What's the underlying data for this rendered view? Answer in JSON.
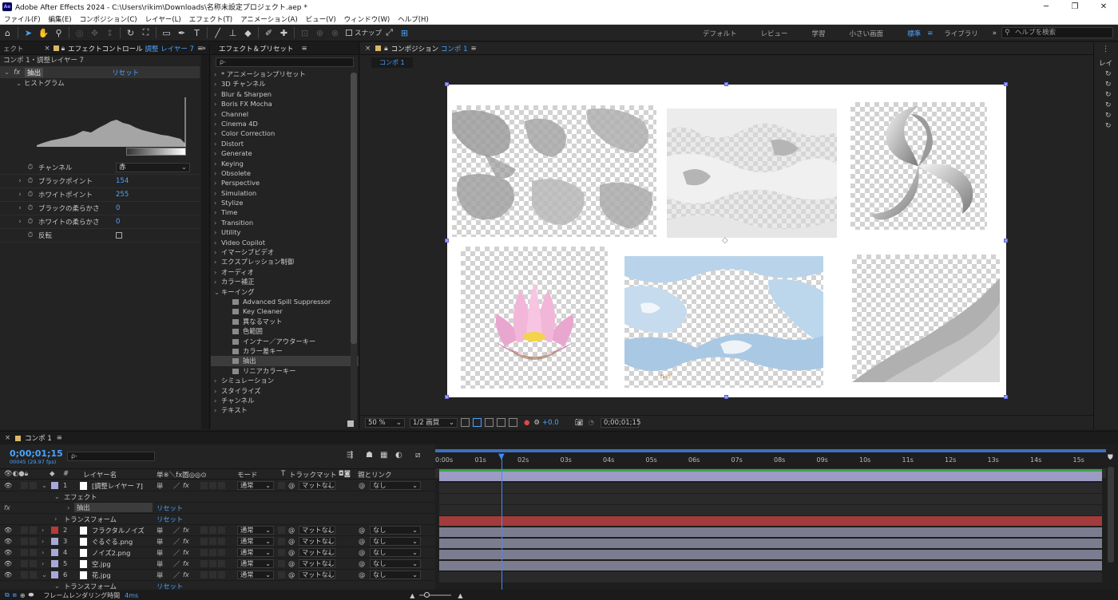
{
  "titlebar": {
    "app_icon": "Ae",
    "title": "Adobe After Effects 2024 - C:\\Users\\rikim\\Downloads\\名称未設定プロジェクト.aep *",
    "minimize": "─",
    "maximize": "❐",
    "close": "✕"
  },
  "menu": [
    "ファイル(F)",
    "編集(E)",
    "コンポジション(C)",
    "レイヤー(L)",
    "エフェクト(T)",
    "アニメーション(A)",
    "ビュー(V)",
    "ウィンドウ(W)",
    "ヘルプ(H)"
  ],
  "toolbar": {
    "snap_label": "スナップ",
    "workspaces": [
      "デフォルト",
      "レビュー",
      "学習",
      "小さい画面",
      "標準",
      "ライブラリ"
    ],
    "active_workspace": "標準",
    "more": "»",
    "help_placeholder": "ヘルプを検索"
  },
  "effect_controls": {
    "tab_left": "ェクト",
    "tab_prefix": "エフェクトコントロール",
    "tab_layer": "調整 レイヤー 7",
    "menu_icon": "≡",
    "subtitle": "コンポ 1・調整レイヤー 7",
    "effect_name": "抽出",
    "reset": "リセット",
    "histogram_label": "ヒストグラム",
    "channel_label": "チャンネル",
    "channel_value": "赤",
    "black_point_label": "ブラックポイント",
    "black_point_value": "154",
    "white_point_label": "ホワイトポイント",
    "white_point_value": "255",
    "black_soft_label": "ブラックの柔らかさ",
    "black_soft_value": "0",
    "white_soft_label": "ホワイトの柔らかさ",
    "white_soft_value": "0",
    "invert_label": "反転"
  },
  "effects_presets": {
    "tab": "エフェクト＆プリセット",
    "menu_icon": "≡",
    "search_placeholder": "ρ-",
    "items": [
      "* アニメーションプリセット",
      "3D チャンネル",
      "Blur & Sharpen",
      "Boris FX Mocha",
      "Channel",
      "Cinema 4D",
      "Color Correction",
      "Distort",
      "Generate",
      "Keying",
      "Obsolete",
      "Perspective",
      "Simulation",
      "Stylize",
      "Time",
      "Transition",
      "Utility",
      "Video Copilot",
      "イマーシブビデオ",
      "エクスプレッション制御",
      "オーディオ",
      "カラー補正"
    ],
    "expanded": "キーイング",
    "children": [
      "Advanced Spill Suppressor",
      "Key Cleaner",
      "異なるマット",
      "色範囲",
      "インナー／アウターキー",
      "カラー差キー",
      "抽出",
      "リニアカラーキー"
    ],
    "selected_child": "抽出",
    "items_after": [
      "シミュレーション",
      "スタイライズ",
      "チャンネル",
      "テキスト"
    ]
  },
  "composition": {
    "tab_prefix": "コンポジション",
    "tab_comp": "コンポ 1",
    "menu_icon": "≡",
    "subtab": "コンポ 1",
    "zoom": "50 %",
    "resolution": "1/2 画質",
    "exposure": "+0.0",
    "timecode": "0;00;01;15",
    "label_orange": "ｵﾚﾝｼﾞ"
  },
  "comp_right_panel": {
    "tab": "レイ"
  },
  "timeline": {
    "tab": "コンポ 1",
    "menu_icon": "≡",
    "timecode": "0;00;01;15",
    "frames": "00045 (29.97 fps)",
    "search_placeholder": "ρ-",
    "headers": {
      "num": "#",
      "name": "レイヤー名",
      "switches": "单※＼fx圖◎◎⊙",
      "mode": "モード",
      "t": "T",
      "trackmatte": "トラックマット",
      "parent": "親とリンク"
    },
    "ruler": [
      "0:00s",
      "01s",
      "02s",
      "03s",
      "04s",
      "05s",
      "06s",
      "07s",
      "08s",
      "09s",
      "10s",
      "11s",
      "12s",
      "13s",
      "14s",
      "15s"
    ],
    "layers": [
      {
        "num": "1",
        "name": "[調整レイヤー 7]",
        "label_color": "#a8a8d8",
        "mode": "通常",
        "matte": "マットなし",
        "parent": "なし"
      },
      {
        "num": "2",
        "name": "フラクタルノイズ",
        "label_color": "#b83a3a",
        "mode": "通常",
        "matte": "マットなし",
        "parent": "なし"
      },
      {
        "num": "3",
        "name": "ぐるぐる.png",
        "label_color": "#a8a8d8",
        "mode": "通常",
        "matte": "マットなし",
        "parent": "なし"
      },
      {
        "num": "4",
        "name": "ノイズ2.png",
        "label_color": "#a8a8d8",
        "mode": "通常",
        "matte": "マットなし",
        "parent": "なし"
      },
      {
        "num": "5",
        "name": "空.jpg",
        "label_color": "#a8a8d8",
        "mode": "通常",
        "matte": "マットなし",
        "parent": "なし"
      },
      {
        "num": "6",
        "name": "花.jpg",
        "label_color": "#a8a8d8",
        "mode": "通常",
        "matte": "マットなし",
        "parent": "なし"
      }
    ],
    "effect_group": "エフェクト",
    "effect_item": "抽出",
    "reset": "リセット",
    "transform": "トランスフォーム",
    "bottom_label": "フレームレンダリング時間",
    "bottom_value": "4ms"
  }
}
